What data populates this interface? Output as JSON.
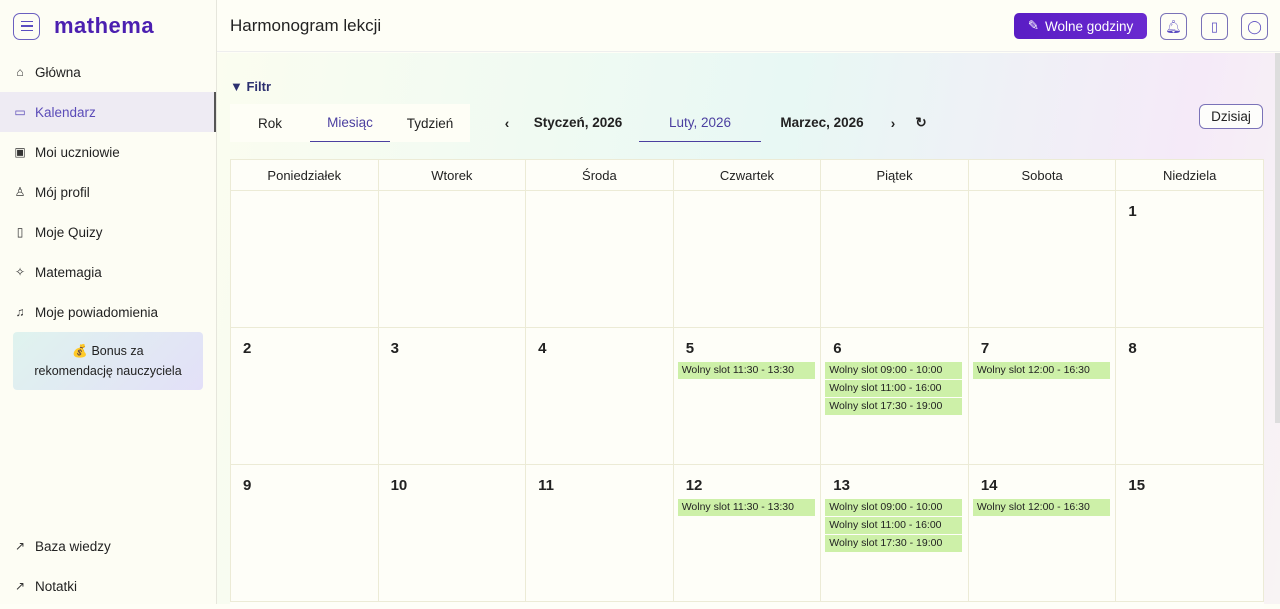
{
  "sidebar": {
    "logo": "mathema",
    "items": [
      {
        "label": "Główna",
        "icon": "home-icon"
      },
      {
        "label": "Kalendarz",
        "icon": "calendar-icon",
        "active": true
      },
      {
        "label": "Moi uczniowie",
        "icon": "students-icon"
      },
      {
        "label": "Mój profil",
        "icon": "user-icon"
      },
      {
        "label": "Moje Quizy",
        "icon": "bookmark-icon"
      },
      {
        "label": "Matemagia",
        "icon": "sparkle-icon"
      },
      {
        "label": "Moje powiadomienia",
        "icon": "bell-icon"
      }
    ],
    "bonus": "💰 Bonus za rekomendację nauczyciela",
    "bottom": [
      {
        "label": "Baza wiedzy",
        "icon": "external-link-icon"
      },
      {
        "label": "Notatki",
        "icon": "external-link-icon"
      }
    ]
  },
  "header": {
    "title": "Harmonogram lekcji",
    "wolne_label": "Wolne godziny"
  },
  "toolbar": {
    "filter": "Filtr",
    "views": [
      "Rok",
      "Miesiąc",
      "Tydzień"
    ],
    "selected_view": "Miesiąc",
    "prev_month": "Styczeń, 2026",
    "current_month": "Luty, 2026",
    "next_month": "Marzec, 2026",
    "today": "Dzisiaj"
  },
  "calendar": {
    "weekdays": [
      "Poniedziałek",
      "Wtorek",
      "Środa",
      "Czwartek",
      "Piątek",
      "Sobota",
      "Niedziela"
    ],
    "weeks": [
      [
        {
          "d": ""
        },
        {
          "d": ""
        },
        {
          "d": ""
        },
        {
          "d": ""
        },
        {
          "d": ""
        },
        {
          "d": ""
        },
        {
          "d": "1"
        }
      ],
      [
        {
          "d": "2"
        },
        {
          "d": "3"
        },
        {
          "d": "4"
        },
        {
          "d": "5",
          "ev": [
            "Wolny slot 11:30 - 13:30"
          ]
        },
        {
          "d": "6",
          "ev": [
            "Wolny slot 09:00 - 10:00",
            "Wolny slot 11:00 - 16:00",
            "Wolny slot 17:30 - 19:00"
          ]
        },
        {
          "d": "7",
          "ev": [
            "Wolny slot 12:00 - 16:30"
          ]
        },
        {
          "d": "8"
        }
      ],
      [
        {
          "d": "9"
        },
        {
          "d": "10"
        },
        {
          "d": "11"
        },
        {
          "d": "12",
          "ev": [
            "Wolny slot 11:30 - 13:30"
          ]
        },
        {
          "d": "13",
          "ev": [
            "Wolny slot 09:00 - 10:00",
            "Wolny slot 11:00 - 16:00",
            "Wolny slot 17:30 - 19:00"
          ]
        },
        {
          "d": "14",
          "ev": [
            "Wolny slot 12:00 - 16:30"
          ]
        },
        {
          "d": "15"
        }
      ]
    ]
  }
}
